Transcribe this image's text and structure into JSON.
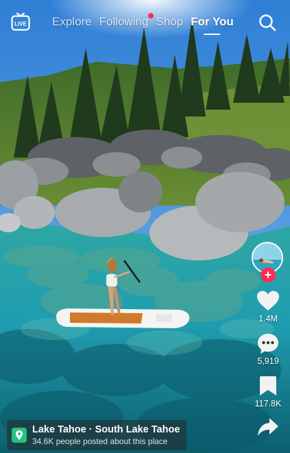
{
  "top_nav": {
    "tabs": [
      {
        "label": "Explore"
      },
      {
        "label": "Following"
      },
      {
        "label": "Shop"
      },
      {
        "label": "For You"
      }
    ]
  },
  "actions": {
    "likes": "1.4M",
    "comments": "5,919",
    "saves": "117.8K"
  },
  "location": {
    "title": "Lake Tahoe · South Lake Tahoe",
    "subtitle": "34.6K people posted about this place"
  },
  "colors": {
    "accent": "#fe2c55",
    "location_pin": "#25c280"
  },
  "icons": [
    "live-icon",
    "search-icon",
    "heart-icon",
    "comment-icon",
    "bookmark-icon",
    "share-icon",
    "location-pin-icon"
  ]
}
